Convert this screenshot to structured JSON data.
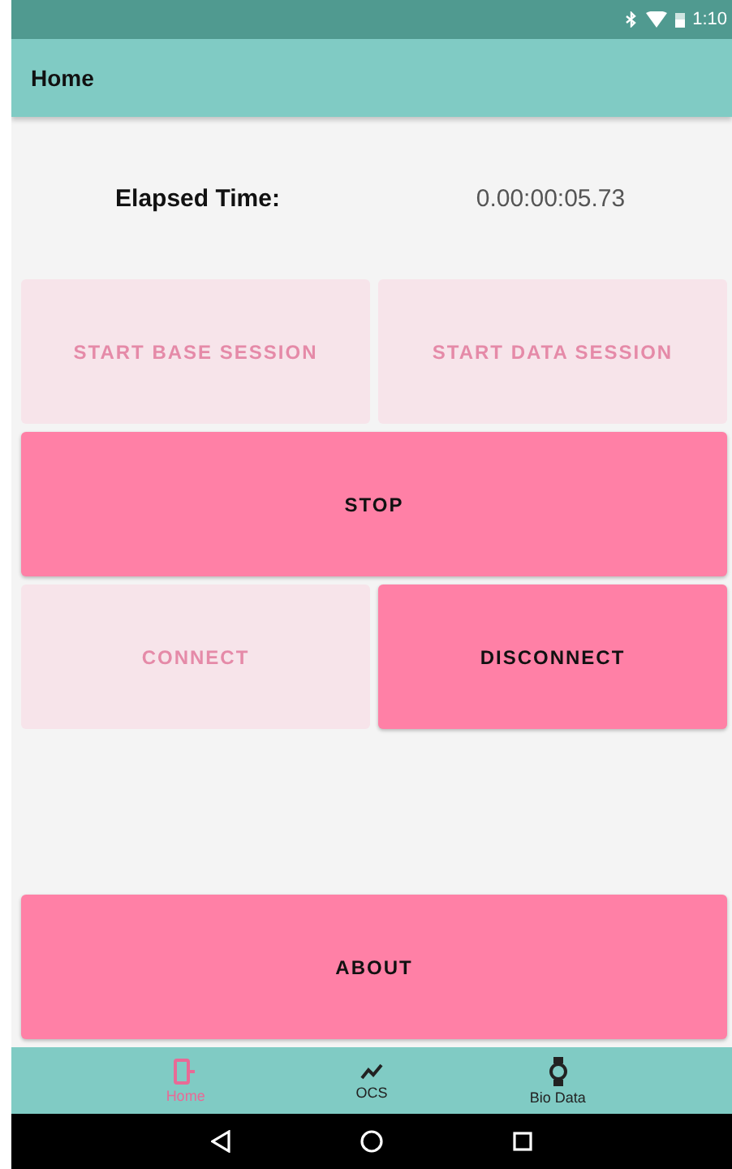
{
  "status_bar": {
    "time": "1:10"
  },
  "app_bar": {
    "title": "Home"
  },
  "elapsed": {
    "label": "Elapsed Time:",
    "value": "0.00:00:05.73"
  },
  "button_rows": [
    [
      {
        "label": "START BASE SESSION",
        "disabled": true
      },
      {
        "label": "START DATA SESSION",
        "disabled": true
      }
    ],
    [
      {
        "label": "STOP",
        "disabled": false
      }
    ],
    [
      {
        "label": "CONNECT",
        "disabled": true
      },
      {
        "label": "DISCONNECT",
        "disabled": false
      }
    ]
  ],
  "about_button": {
    "label": "ABOUT",
    "disabled": false
  },
  "bottom_nav": [
    {
      "label": "Home",
      "kind": "phone",
      "selected": true
    },
    {
      "label": "OCS",
      "kind": "trend",
      "selected": false
    },
    {
      "label": "Bio Data",
      "kind": "watch",
      "selected": false
    }
  ]
}
